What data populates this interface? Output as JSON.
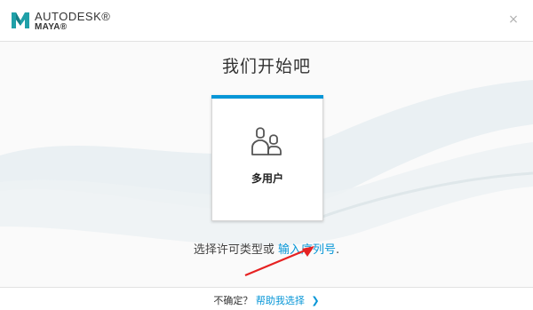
{
  "colors": {
    "accent": "#0696d7",
    "brand_teal": "#1fa0a8",
    "link": "#0696d7",
    "annotation_arrow": "#e62222"
  },
  "header": {
    "brand_line1": "AUTODESK®",
    "brand_line2": "MAYA®",
    "logo_icon": "maya-logo-icon",
    "close_label": "×"
  },
  "main": {
    "title": "我们开始吧",
    "card": {
      "icon": "multi-user-icon",
      "label": "多用户"
    },
    "prompt_text": "选择许可类型或",
    "serial_link": "输入序列号",
    "prompt_end": "."
  },
  "footer": {
    "question": "不确定？",
    "help_link": "帮助我选择",
    "chevron": "❯"
  }
}
